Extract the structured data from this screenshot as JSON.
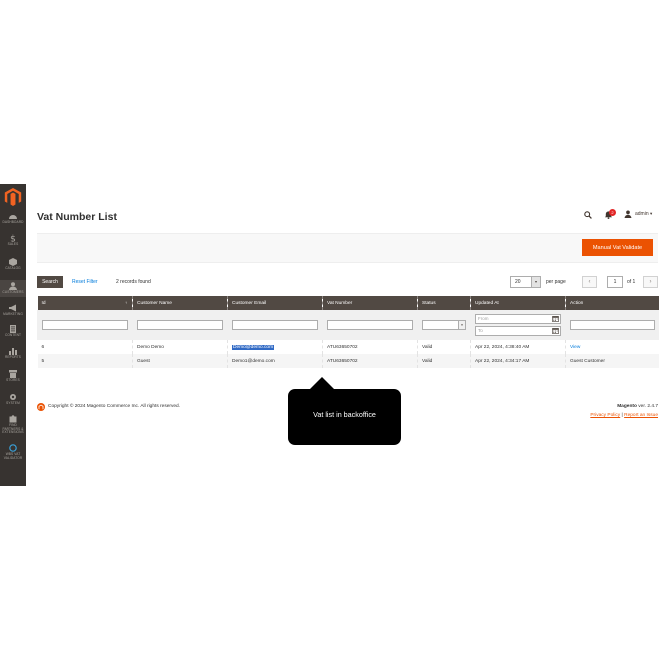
{
  "sidebar": {
    "items": [
      {
        "icon": "dashboard-icon",
        "label": "DASHBOARD"
      },
      {
        "icon": "dollar-icon",
        "label": "SALES"
      },
      {
        "icon": "cube-icon",
        "label": "CATALOG"
      },
      {
        "icon": "customers-icon",
        "label": "CUSTOMERS"
      },
      {
        "icon": "megaphone-icon",
        "label": "MARKETING"
      },
      {
        "icon": "content-icon",
        "label": "CONTENT"
      },
      {
        "icon": "bar-chart-icon",
        "label": "REPORTS"
      },
      {
        "icon": "store-icon",
        "label": "STORES"
      },
      {
        "icon": "gear-icon",
        "label": "SYSTEM"
      },
      {
        "icon": "puzzle-icon",
        "label": "FIND PARTNERS & EXTENSIONS"
      },
      {
        "icon": "vat-validator-icon",
        "label": "WBS VAT VALIDATOR"
      }
    ]
  },
  "header": {
    "title": "Vat Number List",
    "notification_count": "2",
    "username": "admin"
  },
  "actions": {
    "primary_button": "Manual Vat Validate"
  },
  "toolbar": {
    "search_label": "Search",
    "reset_label": "Reset Filter",
    "records_found": "2 records found",
    "page_size": "20",
    "per_page_label": "per page",
    "prev_label": "‹",
    "next_label": "›",
    "current_page": "1",
    "of_pages": "of 1"
  },
  "grid": {
    "columns": [
      "Id",
      "Customer Name",
      "Customer Email",
      "Vat Number",
      "Status",
      "Updated At",
      "Action"
    ],
    "filter_from_placeholder": "From",
    "filter_to_placeholder": "To",
    "rows": [
      {
        "id": "6",
        "name": "Demo Demo",
        "email": "Demo@demo.com",
        "vat": "ATU63650702",
        "status": "Valid",
        "updated": "Apr 22, 2024, 4:38:40 AM",
        "action": "View"
      },
      {
        "id": "5",
        "name": "Guest",
        "email": "Demo1@demo.com",
        "vat": "ATU63650702",
        "status": "Valid",
        "updated": "Apr 22, 2024, 4:34:17 AM",
        "action": "Guest Customer"
      }
    ]
  },
  "footer": {
    "copyright": "Copyright © 2024 Magento Commerce Inc. All rights reserved.",
    "version_label": "Magento",
    "version_value": "ver. 2.4.7",
    "privacy_label": "Privacy Policy",
    "separator": "|",
    "report_label": "Report an Issue"
  },
  "tooltip": {
    "text": "Vat list in backoffice"
  },
  "colors": {
    "sidebar_bg": "#373330",
    "accent": "#eb5202",
    "grid_header_bg": "#514943",
    "link": "#007bdb"
  }
}
